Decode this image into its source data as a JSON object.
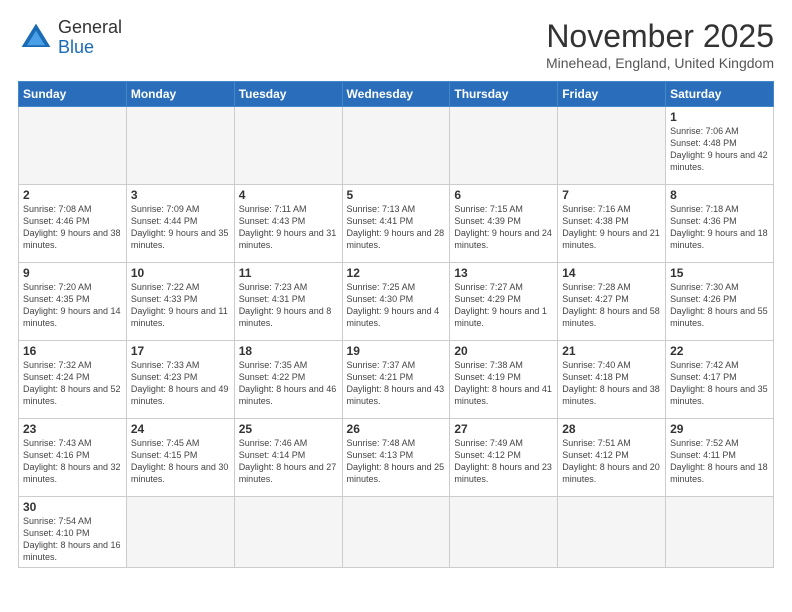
{
  "header": {
    "logo_line1": "General",
    "logo_line2": "Blue",
    "month_title": "November 2025",
    "location": "Minehead, England, United Kingdom"
  },
  "weekdays": [
    "Sunday",
    "Monday",
    "Tuesday",
    "Wednesday",
    "Thursday",
    "Friday",
    "Saturday"
  ],
  "weeks": [
    [
      {
        "day": "",
        "info": ""
      },
      {
        "day": "",
        "info": ""
      },
      {
        "day": "",
        "info": ""
      },
      {
        "day": "",
        "info": ""
      },
      {
        "day": "",
        "info": ""
      },
      {
        "day": "",
        "info": ""
      },
      {
        "day": "1",
        "info": "Sunrise: 7:06 AM\nSunset: 4:48 PM\nDaylight: 9 hours\nand 42 minutes."
      }
    ],
    [
      {
        "day": "2",
        "info": "Sunrise: 7:08 AM\nSunset: 4:46 PM\nDaylight: 9 hours\nand 38 minutes."
      },
      {
        "day": "3",
        "info": "Sunrise: 7:09 AM\nSunset: 4:44 PM\nDaylight: 9 hours\nand 35 minutes."
      },
      {
        "day": "4",
        "info": "Sunrise: 7:11 AM\nSunset: 4:43 PM\nDaylight: 9 hours\nand 31 minutes."
      },
      {
        "day": "5",
        "info": "Sunrise: 7:13 AM\nSunset: 4:41 PM\nDaylight: 9 hours\nand 28 minutes."
      },
      {
        "day": "6",
        "info": "Sunrise: 7:15 AM\nSunset: 4:39 PM\nDaylight: 9 hours\nand 24 minutes."
      },
      {
        "day": "7",
        "info": "Sunrise: 7:16 AM\nSunset: 4:38 PM\nDaylight: 9 hours\nand 21 minutes."
      },
      {
        "day": "8",
        "info": "Sunrise: 7:18 AM\nSunset: 4:36 PM\nDaylight: 9 hours\nand 18 minutes."
      }
    ],
    [
      {
        "day": "9",
        "info": "Sunrise: 7:20 AM\nSunset: 4:35 PM\nDaylight: 9 hours\nand 14 minutes."
      },
      {
        "day": "10",
        "info": "Sunrise: 7:22 AM\nSunset: 4:33 PM\nDaylight: 9 hours\nand 11 minutes."
      },
      {
        "day": "11",
        "info": "Sunrise: 7:23 AM\nSunset: 4:31 PM\nDaylight: 9 hours\nand 8 minutes."
      },
      {
        "day": "12",
        "info": "Sunrise: 7:25 AM\nSunset: 4:30 PM\nDaylight: 9 hours\nand 4 minutes."
      },
      {
        "day": "13",
        "info": "Sunrise: 7:27 AM\nSunset: 4:29 PM\nDaylight: 9 hours\nand 1 minute."
      },
      {
        "day": "14",
        "info": "Sunrise: 7:28 AM\nSunset: 4:27 PM\nDaylight: 8 hours\nand 58 minutes."
      },
      {
        "day": "15",
        "info": "Sunrise: 7:30 AM\nSunset: 4:26 PM\nDaylight: 8 hours\nand 55 minutes."
      }
    ],
    [
      {
        "day": "16",
        "info": "Sunrise: 7:32 AM\nSunset: 4:24 PM\nDaylight: 8 hours\nand 52 minutes."
      },
      {
        "day": "17",
        "info": "Sunrise: 7:33 AM\nSunset: 4:23 PM\nDaylight: 8 hours\nand 49 minutes."
      },
      {
        "day": "18",
        "info": "Sunrise: 7:35 AM\nSunset: 4:22 PM\nDaylight: 8 hours\nand 46 minutes."
      },
      {
        "day": "19",
        "info": "Sunrise: 7:37 AM\nSunset: 4:21 PM\nDaylight: 8 hours\nand 43 minutes."
      },
      {
        "day": "20",
        "info": "Sunrise: 7:38 AM\nSunset: 4:19 PM\nDaylight: 8 hours\nand 41 minutes."
      },
      {
        "day": "21",
        "info": "Sunrise: 7:40 AM\nSunset: 4:18 PM\nDaylight: 8 hours\nand 38 minutes."
      },
      {
        "day": "22",
        "info": "Sunrise: 7:42 AM\nSunset: 4:17 PM\nDaylight: 8 hours\nand 35 minutes."
      }
    ],
    [
      {
        "day": "23",
        "info": "Sunrise: 7:43 AM\nSunset: 4:16 PM\nDaylight: 8 hours\nand 32 minutes."
      },
      {
        "day": "24",
        "info": "Sunrise: 7:45 AM\nSunset: 4:15 PM\nDaylight: 8 hours\nand 30 minutes."
      },
      {
        "day": "25",
        "info": "Sunrise: 7:46 AM\nSunset: 4:14 PM\nDaylight: 8 hours\nand 27 minutes."
      },
      {
        "day": "26",
        "info": "Sunrise: 7:48 AM\nSunset: 4:13 PM\nDaylight: 8 hours\nand 25 minutes."
      },
      {
        "day": "27",
        "info": "Sunrise: 7:49 AM\nSunset: 4:12 PM\nDaylight: 8 hours\nand 23 minutes."
      },
      {
        "day": "28",
        "info": "Sunrise: 7:51 AM\nSunset: 4:12 PM\nDaylight: 8 hours\nand 20 minutes."
      },
      {
        "day": "29",
        "info": "Sunrise: 7:52 AM\nSunset: 4:11 PM\nDaylight: 8 hours\nand 18 minutes."
      }
    ],
    [
      {
        "day": "30",
        "info": "Sunrise: 7:54 AM\nSunset: 4:10 PM\nDaylight: 8 hours\nand 16 minutes."
      },
      {
        "day": "",
        "info": ""
      },
      {
        "day": "",
        "info": ""
      },
      {
        "day": "",
        "info": ""
      },
      {
        "day": "",
        "info": ""
      },
      {
        "day": "",
        "info": ""
      },
      {
        "day": "",
        "info": ""
      }
    ]
  ]
}
